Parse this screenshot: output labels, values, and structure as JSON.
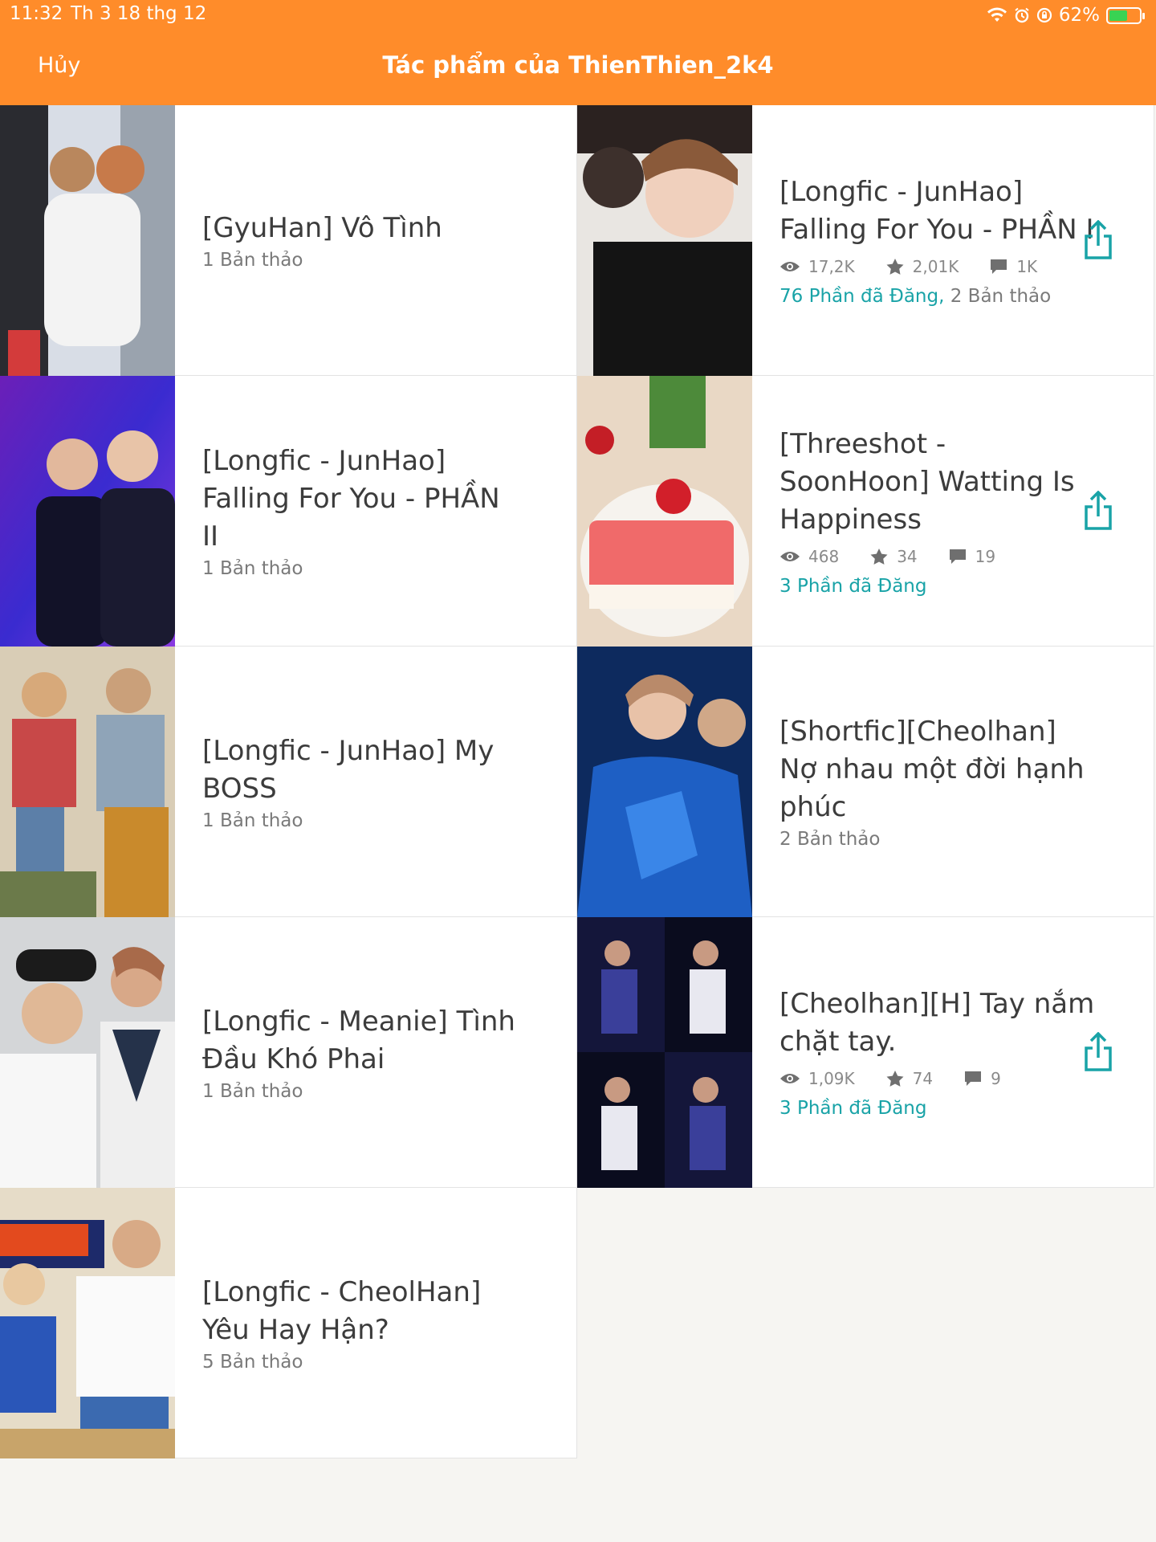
{
  "status_bar": {
    "time": "11:32",
    "date": "Th 3 18 thg 12",
    "battery": "62%",
    "battery_level": 0.62
  },
  "header": {
    "cancel_label": "Hủy",
    "title": "Tác phẩm của ThienThien_2k4"
  },
  "colors": {
    "accent": "#ff8c2a",
    "teal": "#19a3a7"
  },
  "stories": [
    {
      "title": "[GyuHan] Vô Tình",
      "drafts": "1 Bản thảo"
    },
    {
      "title": "[Longfic - JunHao] Falling For You - PHẦN I",
      "views": "17,2K",
      "votes": "2,01K",
      "comments": "1K",
      "published": "76 Phần đã Đăng,",
      "drafts": "2 Bản thảo"
    },
    {
      "title": "[Longfic - JunHao] Falling For You - PHẦN II",
      "drafts": "1 Bản thảo"
    },
    {
      "title": "[Threeshot - SoonHoon] Watting Is Happiness",
      "views": "468",
      "votes": "34",
      "comments": "19",
      "published": "3 Phần đã Đăng"
    },
    {
      "title": "[Longfic - JunHao] My BOSS",
      "drafts": "1 Bản thảo"
    },
    {
      "title": "[Shortfic][Cheolhan] Nợ nhau một đời hạnh phúc",
      "drafts": "2 Bản thảo"
    },
    {
      "title": "[Longfic - Meanie] Tình Đầu Khó Phai",
      "drafts": "1 Bản thảo"
    },
    {
      "title": "[Cheolhan][H] Tay nắm chặt tay.",
      "views": "1,09K",
      "votes": "74",
      "comments": "9",
      "published": "3 Phần đã Đăng"
    },
    {
      "title": "[Longfic - CheolHan] Yêu Hay Hận?",
      "drafts": "5 Bản thảo"
    }
  ]
}
